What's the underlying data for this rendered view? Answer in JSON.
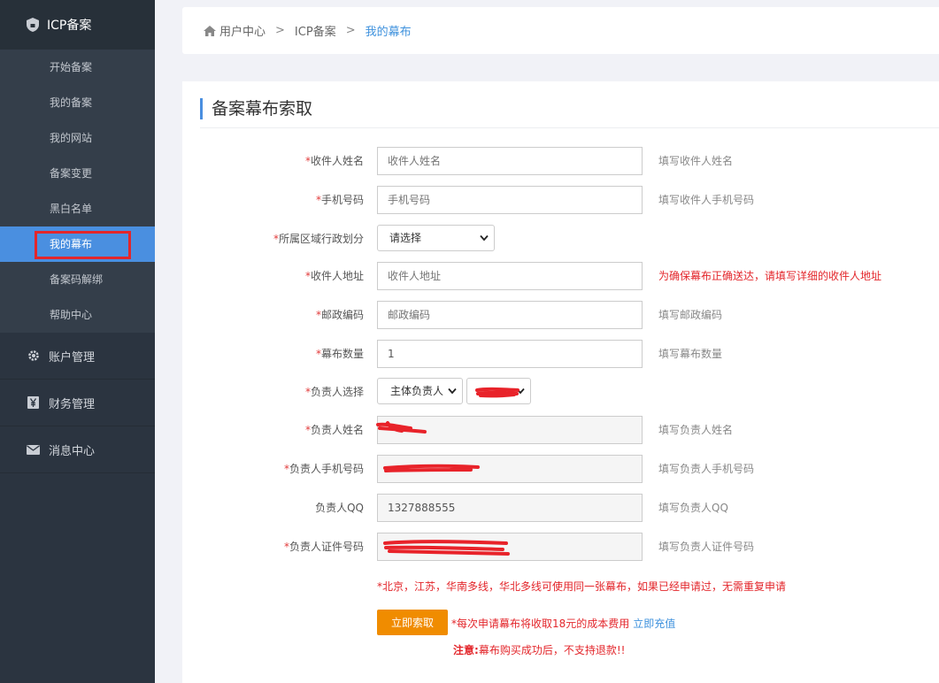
{
  "sidebar": {
    "header": "ICP备案",
    "sub_items": [
      {
        "label": "开始备案"
      },
      {
        "label": "我的备案"
      },
      {
        "label": "我的网站"
      },
      {
        "label": "备案变更"
      },
      {
        "label": "黑白名单"
      },
      {
        "label": "我的幕布",
        "active": true
      },
      {
        "label": "备案码解绑"
      },
      {
        "label": "帮助中心"
      }
    ],
    "groups": [
      {
        "label": "账户管理",
        "icon": "gear-icon"
      },
      {
        "label": "财务管理",
        "icon": "yen-icon"
      },
      {
        "label": "消息中心",
        "icon": "envelope-icon"
      }
    ]
  },
  "breadcrumb": {
    "home": "用户中心",
    "sep": ">",
    "middle": "ICP备案",
    "current": "我的幕布"
  },
  "page": {
    "title": "备案幕布索取"
  },
  "form": {
    "recipient_name": {
      "label": "收件人姓名",
      "placeholder": "收件人姓名",
      "hint": "填写收件人姓名"
    },
    "phone": {
      "label": "手机号码",
      "placeholder": "手机号码",
      "hint": "填写收件人手机号码"
    },
    "region": {
      "label": "所属区域行政划分",
      "value": "请选择"
    },
    "address": {
      "label": "收件人地址",
      "placeholder": "收件人地址",
      "hint": "为确保幕布正确送达，请填写详细的收件人地址"
    },
    "postcode": {
      "label": "邮政编码",
      "placeholder": "邮政编码",
      "hint": "填写邮政编码"
    },
    "quantity": {
      "label": "幕布数量",
      "value": "1",
      "hint": "填写幕布数量"
    },
    "principal_select": {
      "label": "负责人选择",
      "value": "主体负责人"
    },
    "principal_name": {
      "label": "负责人姓名",
      "hint": "填写负责人姓名"
    },
    "principal_phone": {
      "label": "负责人手机号码",
      "hint": "填写负责人手机号码"
    },
    "principal_qq": {
      "label": "负责人QQ",
      "value": "1327888555",
      "hint": "填写负责人QQ"
    },
    "principal_id": {
      "label": "负责人证件号码",
      "hint": "填写负责人证件号码"
    },
    "required_mark": "*"
  },
  "notes": {
    "multiline": "*北京，江苏，华南多线，华北多线可使用同一张幕布，如果已经申请过，无需重复申请",
    "submit_label": "立即索取",
    "fee": "*每次申请幕布将收取18元的成本费用",
    "recharge_link": "立即充值",
    "warning_bold": "注意:",
    "warning_text": "幕布购买成功后，不支持退款!!"
  },
  "colors": {
    "sidebar_bg": "#2b3440",
    "active_bg": "#4a8fe0",
    "highlight_box": "#e3262b",
    "button": "#f08c00",
    "link": "#3e91dd"
  }
}
